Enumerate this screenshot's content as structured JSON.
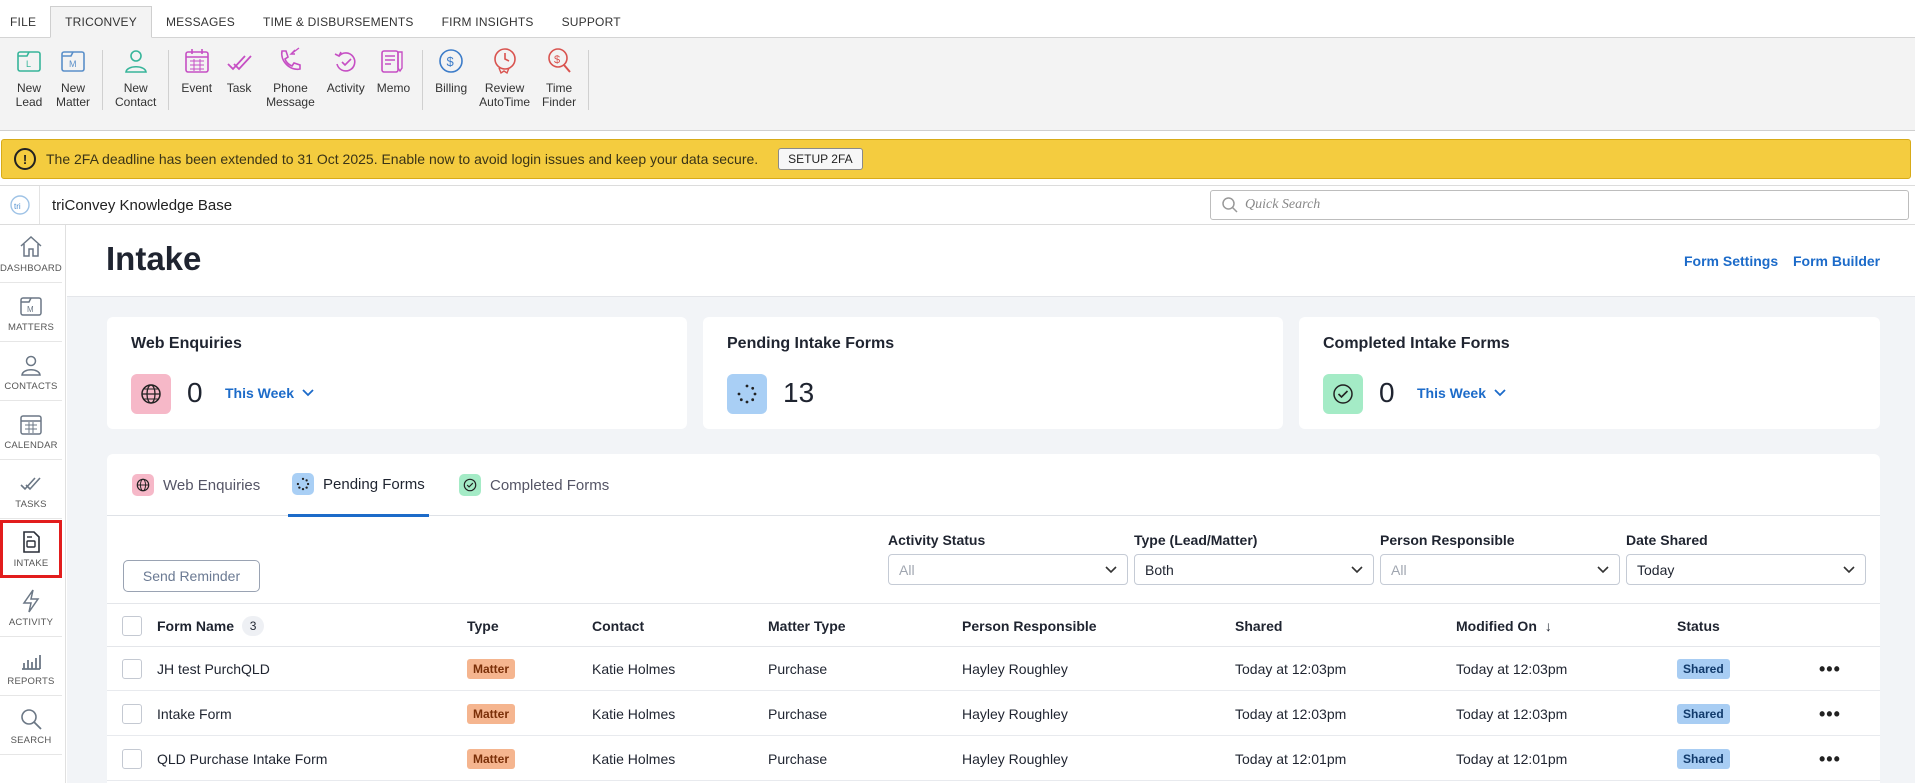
{
  "menu": {
    "items": [
      "FILE",
      "TRICONVEY",
      "MESSAGES",
      "TIME & DISBURSEMENTS",
      "FIRM INSIGHTS",
      "SUPPORT"
    ],
    "active": "TRICONVEY"
  },
  "ribbon": {
    "buttons": [
      {
        "line1": "New",
        "line2": "Lead"
      },
      {
        "line1": "New",
        "line2": "Matter"
      },
      {
        "line1": "New",
        "line2": "Contact"
      },
      {
        "line1": "Event",
        "line2": ""
      },
      {
        "line1": "Task",
        "line2": ""
      },
      {
        "line1": "Phone",
        "line2": "Message"
      },
      {
        "line1": "Activity",
        "line2": ""
      },
      {
        "line1": "Memo",
        "line2": ""
      },
      {
        "line1": "Billing",
        "line2": ""
      },
      {
        "line1": "Review",
        "line2": "AutoTime"
      },
      {
        "line1": "Time",
        "line2": "Finder"
      }
    ]
  },
  "banner": {
    "text": "The 2FA deadline has been extended to 31 Oct 2025. Enable now to avoid login issues and keep your data secure.",
    "button": "SETUP 2FA",
    "icon": "!"
  },
  "kb": {
    "logo": "tri",
    "title": "triConvey Knowledge Base",
    "search_placeholder": "Quick Search"
  },
  "sidebar": {
    "items": [
      {
        "label": "DASHBOARD",
        "icon": "home-icon"
      },
      {
        "label": "MATTERS",
        "icon": "matters-icon"
      },
      {
        "label": "CONTACTS",
        "icon": "contacts-icon"
      },
      {
        "label": "CALENDAR",
        "icon": "calendar-icon"
      },
      {
        "label": "TASKS",
        "icon": "tasks-icon"
      },
      {
        "label": "INTAKE",
        "icon": "intake-icon"
      },
      {
        "label": "ACTIVITY",
        "icon": "activity-icon"
      },
      {
        "label": "REPORTS",
        "icon": "reports-icon"
      },
      {
        "label": "SEARCH",
        "icon": "search-icon"
      }
    ],
    "active": "INTAKE",
    "active_color": "#e21d1d"
  },
  "page": {
    "title": "Intake",
    "links": {
      "form_settings": "Form Settings",
      "form_builder": "Form Builder"
    }
  },
  "cards": {
    "web": {
      "title": "Web Enquiries",
      "count": "0",
      "period": "This Week",
      "badge_color": "#f6b8c8"
    },
    "pending": {
      "title": "Pending Intake Forms",
      "count": "13",
      "badge_color": "#a9cff5"
    },
    "completed": {
      "title": "Completed Intake Forms",
      "count": "0",
      "period": "This Week",
      "badge_color": "#a4ebc6"
    }
  },
  "tabs": {
    "web": "Web Enquiries",
    "pending": "Pending Forms",
    "completed": "Completed Forms",
    "active": "Pending Forms"
  },
  "filters": {
    "send_reminder": "Send Reminder",
    "activity_status": {
      "label": "Activity Status",
      "value": "All"
    },
    "type": {
      "label": "Type (Lead/Matter)",
      "value": "Both"
    },
    "person": {
      "label": "Person Responsible",
      "value": "All"
    },
    "date": {
      "label": "Date Shared",
      "value": "Today"
    }
  },
  "table": {
    "columns": {
      "form_name": "Form Name",
      "type": "Type",
      "contact": "Contact",
      "matter_type": "Matter Type",
      "person": "Person Responsible",
      "shared": "Shared",
      "modified": "Modified On",
      "status": "Status"
    },
    "selected_count": "3",
    "sort_indicator": "↓",
    "rows": [
      {
        "form_name": "JH test PurchQLD",
        "type": "Matter",
        "contact": "Katie Holmes",
        "matter_type": "Purchase",
        "person": "Hayley Roughley",
        "shared": "Today at 12:03pm",
        "modified": "Today at 12:03pm",
        "status": "Shared",
        "more": "•••"
      },
      {
        "form_name": "Intake Form",
        "type": "Matter",
        "contact": "Katie Holmes",
        "matter_type": "Purchase",
        "person": "Hayley Roughley",
        "shared": "Today at 12:03pm",
        "modified": "Today at 12:03pm",
        "status": "Shared",
        "more": "•••"
      },
      {
        "form_name": "QLD Purchase Intake Form",
        "type": "Matter",
        "contact": "Katie Holmes",
        "matter_type": "Purchase",
        "person": "Hayley Roughley",
        "shared": "Today at 12:01pm",
        "modified": "Today at 12:01pm",
        "status": "Shared",
        "more": "•••"
      }
    ]
  }
}
